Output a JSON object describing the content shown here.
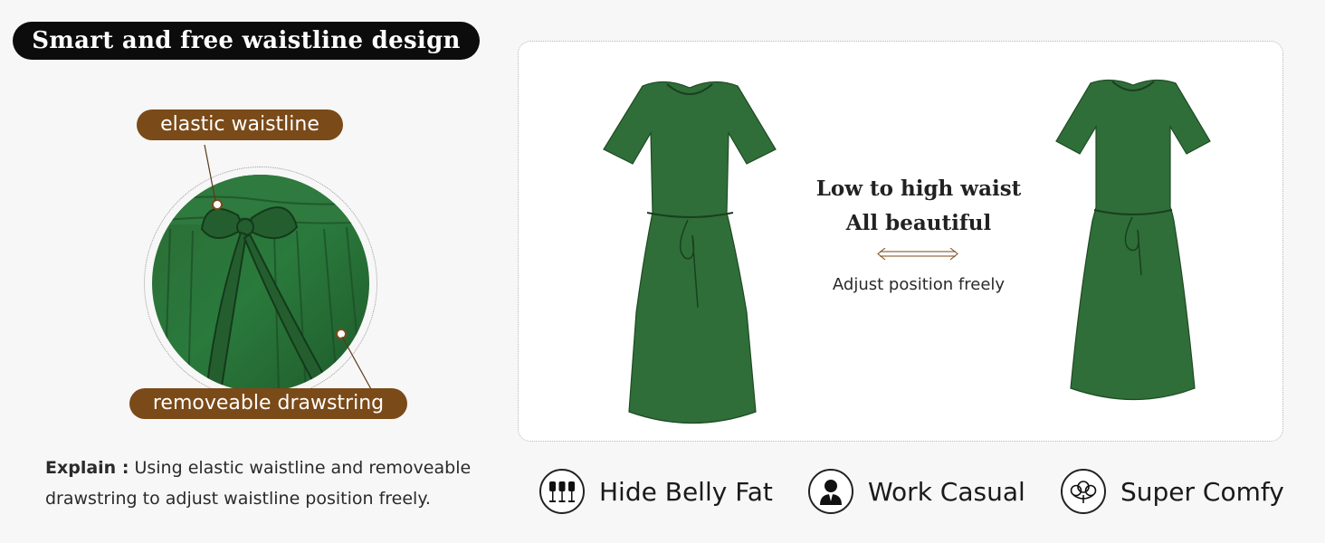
{
  "title": "Smart and free waistline design",
  "labels": {
    "elastic": "elastic waistline",
    "drawstring": "removeable drawstring"
  },
  "explain": {
    "prefix": "Explain :",
    "text": " Using elastic waistline and removeable drawstring to adjust waistline position freely."
  },
  "center": {
    "line1": "Low to high waist",
    "line2": "All beautiful",
    "caption": "Adjust position freely"
  },
  "features": [
    {
      "label": "Hide Belly Fat",
      "icon": "mannequins-icon"
    },
    {
      "label": "Work Casual",
      "icon": "business-person-icon"
    },
    {
      "label": "Super Comfy",
      "icon": "cotton-flower-icon"
    }
  ],
  "colors": {
    "dress_green": "#2f6e38",
    "label_brown": "#7a4a18",
    "title_bg": "#0c0c0c"
  }
}
